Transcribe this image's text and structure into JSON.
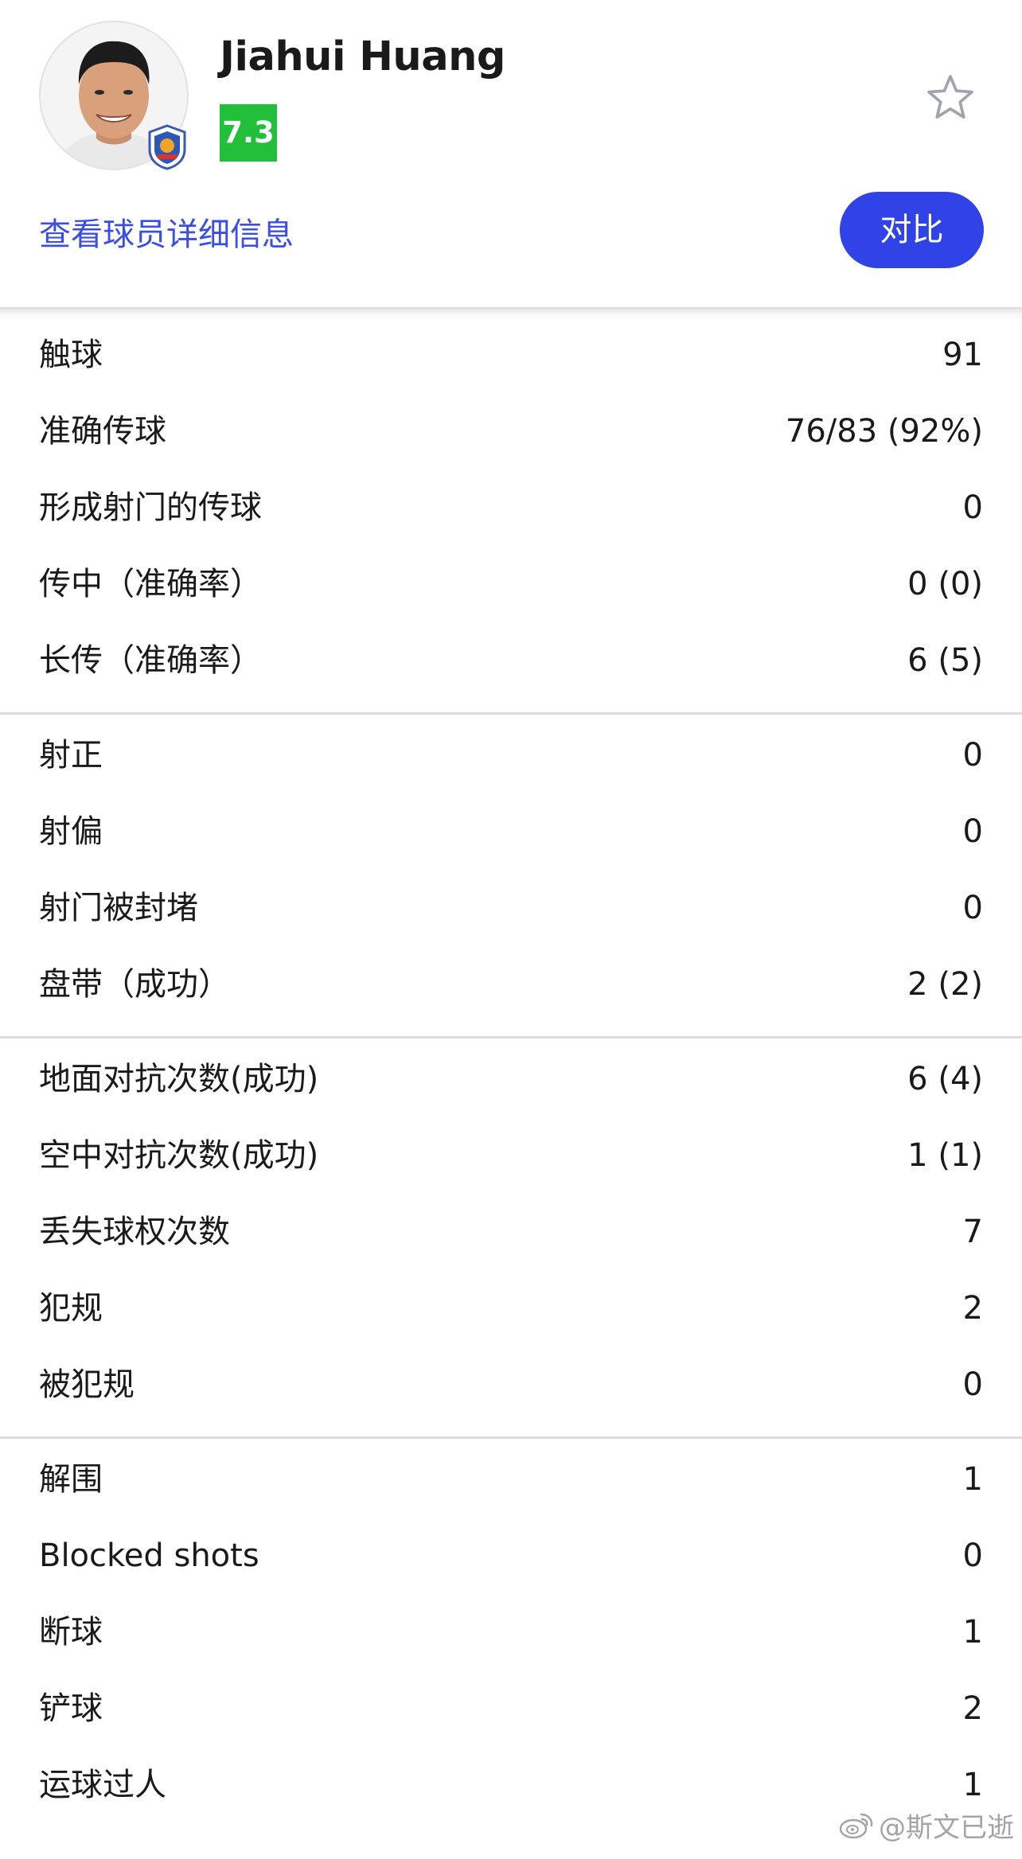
{
  "player": {
    "name": "Jiahui Huang",
    "rating": "7.3",
    "details_link": "查看球员详细信息",
    "compare_label": "对比",
    "rating_color": "#22bf3a",
    "accent_color": "#2f43e6",
    "favorite_icon": "star-outline-icon"
  },
  "stat_groups": [
    {
      "rows": [
        {
          "label": "触球",
          "value": "91"
        },
        {
          "label": "准确传球",
          "value": "76/83 (92%)"
        },
        {
          "label": "形成射门的传球",
          "value": "0"
        },
        {
          "label": "传中（准确率）",
          "value": "0 (0)"
        },
        {
          "label": "长传（准确率）",
          "value": "6 (5)"
        }
      ]
    },
    {
      "rows": [
        {
          "label": "射正",
          "value": "0"
        },
        {
          "label": "射偏",
          "value": "0"
        },
        {
          "label": "射门被封堵",
          "value": "0"
        },
        {
          "label": "盘带（成功）",
          "value": "2 (2)"
        }
      ]
    },
    {
      "rows": [
        {
          "label": "地面对抗次数(成功)",
          "value": "6 (4)"
        },
        {
          "label": "空中对抗次数(成功)",
          "value": "1 (1)"
        },
        {
          "label": "丢失球权次数",
          "value": "7"
        },
        {
          "label": "犯规",
          "value": "2"
        },
        {
          "label": "被犯规",
          "value": "0"
        }
      ]
    },
    {
      "rows": [
        {
          "label": "解围",
          "value": "1"
        },
        {
          "label": "Blocked shots",
          "value": "0"
        },
        {
          "label": "断球",
          "value": "1"
        },
        {
          "label": "铲球",
          "value": "2"
        },
        {
          "label": "运球过人",
          "value": "1"
        }
      ]
    }
  ],
  "watermark": {
    "text": "@斯文已逝",
    "icon": "weibo-icon"
  }
}
